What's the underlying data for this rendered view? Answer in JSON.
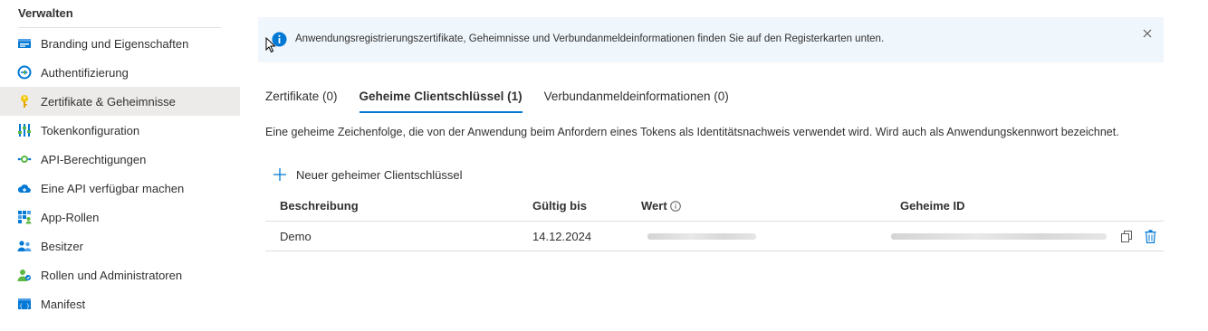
{
  "sidebar": {
    "section_title": "Verwalten",
    "items": [
      {
        "label": "Branding und Eigenschaften",
        "icon": "branding-icon"
      },
      {
        "label": "Authentifizierung",
        "icon": "authentication-icon"
      },
      {
        "label": "Zertifikate & Geheimnisse",
        "icon": "key-icon",
        "active": true
      },
      {
        "label": "Tokenkonfiguration",
        "icon": "token-config-icon"
      },
      {
        "label": "API-Berechtigungen",
        "icon": "api-permissions-icon"
      },
      {
        "label": "Eine API verfügbar machen",
        "icon": "cloud-icon"
      },
      {
        "label": "App-Rollen",
        "icon": "app-roles-icon"
      },
      {
        "label": "Besitzer",
        "icon": "owners-icon"
      },
      {
        "label": "Rollen und Administratoren",
        "icon": "roles-admins-icon"
      },
      {
        "label": "Manifest",
        "icon": "manifest-icon"
      }
    ]
  },
  "info_bar": {
    "text": "Anwendungsregistrierungszertifikate, Geheimnisse und Verbundanmeldeinformationen finden Sie auf den Registerkarten unten.",
    "icon": "info-icon",
    "close_icon": "close-icon"
  },
  "tabs": [
    {
      "label": "Zertifikate (0)"
    },
    {
      "label": "Geheime Clientschlüssel (1)",
      "active": true
    },
    {
      "label": "Verbundanmeldeinformationen (0)"
    }
  ],
  "description": "Eine geheime Zeichenfolge, die von der Anwendung beim Anfordern eines Tokens als Identitätsnachweis verwendet wird. Wird auch als Anwendungskennwort bezeichnet.",
  "add_button": {
    "label": "Neuer geheimer Clientschlüssel",
    "icon": "plus-icon"
  },
  "table": {
    "headers": {
      "description": "Beschreibung",
      "expires": "Gültig bis",
      "value": "Wert",
      "secret_id": "Geheime ID"
    },
    "rows": [
      {
        "description": "Demo",
        "expires": "14.12.2024",
        "value_redacted": true,
        "secret_id_redacted": true
      }
    ]
  },
  "colors": {
    "accent": "#0078d4",
    "info_background": "#eff6fc",
    "active_nav": "#edebe9"
  }
}
